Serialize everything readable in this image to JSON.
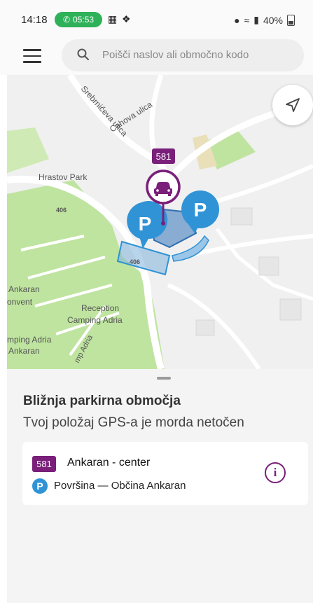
{
  "status_bar": {
    "time": "14:18",
    "call_timer": "05:53",
    "battery": "40%"
  },
  "search": {
    "placeholder": "Poišči naslov ali območno kodo"
  },
  "map": {
    "street_labels": [
      "Srebrničeva ulica",
      "Cahova ulica",
      "Hrastov Park",
      "406",
      "406"
    ],
    "poi_labels": [
      "Ankaran",
      "onvent",
      "Reception",
      "Camping Adria",
      "mping Adria",
      "Ankaran",
      "mp Adria"
    ],
    "zone_code": "581",
    "parking_marker": "P"
  },
  "sheet": {
    "title": "Bližnja parkirna območja",
    "subtitle": "Tvoj položaj GPS-a je morda netočen",
    "item": {
      "zone_code": "581",
      "zone_name": "Ankaran - center",
      "parking_icon": "P",
      "area_type": "Površina — Občina Ankaran"
    }
  },
  "colors": {
    "zone_purple": "#7a1f7a",
    "parking_blue": "#2f93d6",
    "park_green": "#bfe4a0",
    "call_green": "#2fb15a"
  }
}
